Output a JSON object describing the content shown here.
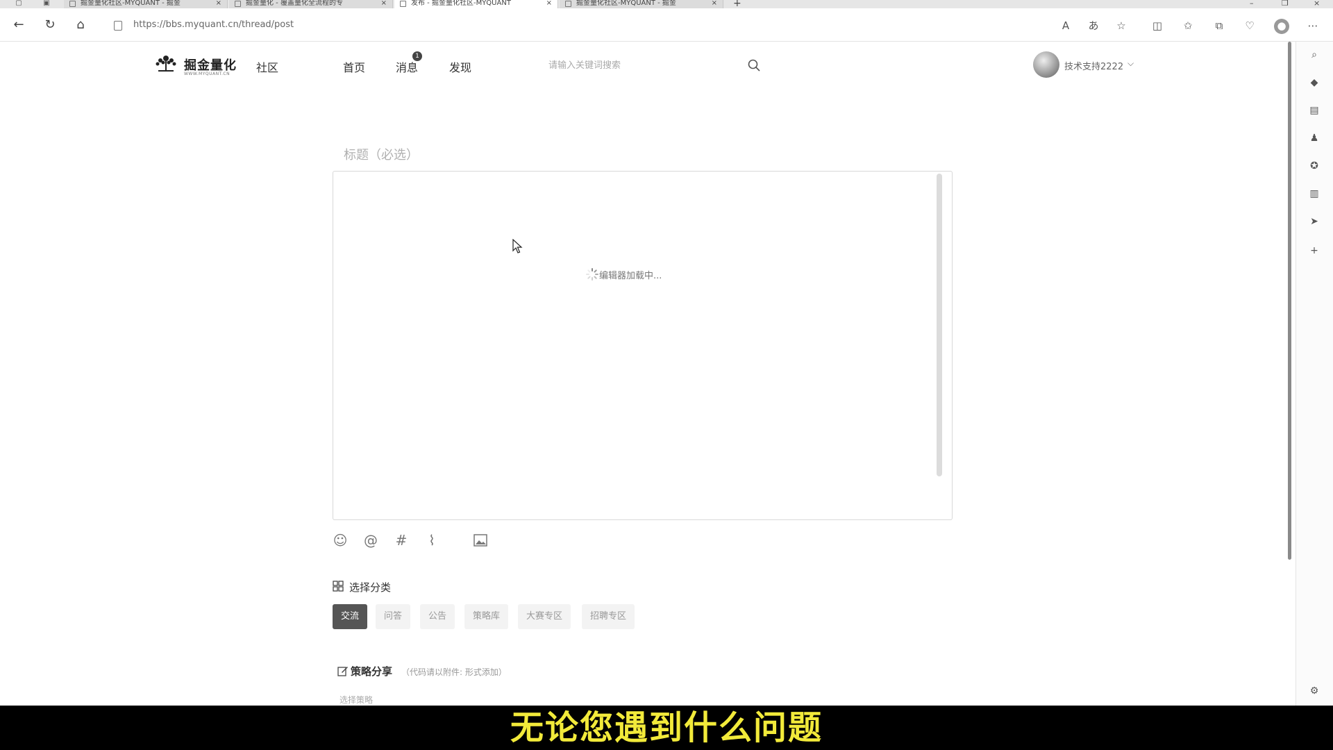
{
  "browser": {
    "tabs": [
      {
        "title": "掘金量化社区-MYQUANT - 掘金"
      },
      {
        "title": "掘金量化 - 覆盖量化全流程的专"
      },
      {
        "title": "发布 - 掘金量化社区-MYQUANT"
      },
      {
        "title": "掘金量化社区-MYQUANT - 掘金"
      }
    ],
    "active_tab": 2,
    "url": "https://bbs.myquant.cn/thread/post"
  },
  "site": {
    "logo_text": "掘金量化",
    "logo_sub": "WWW.MYQUANT.CN",
    "section": "社区",
    "nav": [
      "首页",
      "消息",
      "发现"
    ],
    "message_badge": "1",
    "search_placeholder": "请输入关键词搜索",
    "username": "技术支持2222"
  },
  "post": {
    "title_placeholder": "标题（必选）",
    "editor_loading": "编辑器加载中...",
    "category_heading": "选择分类",
    "categories": [
      "交流",
      "问答",
      "公告",
      "策略库",
      "大赛专区",
      "招聘专区"
    ],
    "selected_category": 0,
    "strategy_heading": "策略分享",
    "strategy_note": "（代码请以附件: 形式添加）",
    "strategy_select": "选择策略"
  },
  "subtitle": "无论您遇到什么问题",
  "colors": {
    "subtitle": "#f2ea3a",
    "active_category": "#555555"
  }
}
